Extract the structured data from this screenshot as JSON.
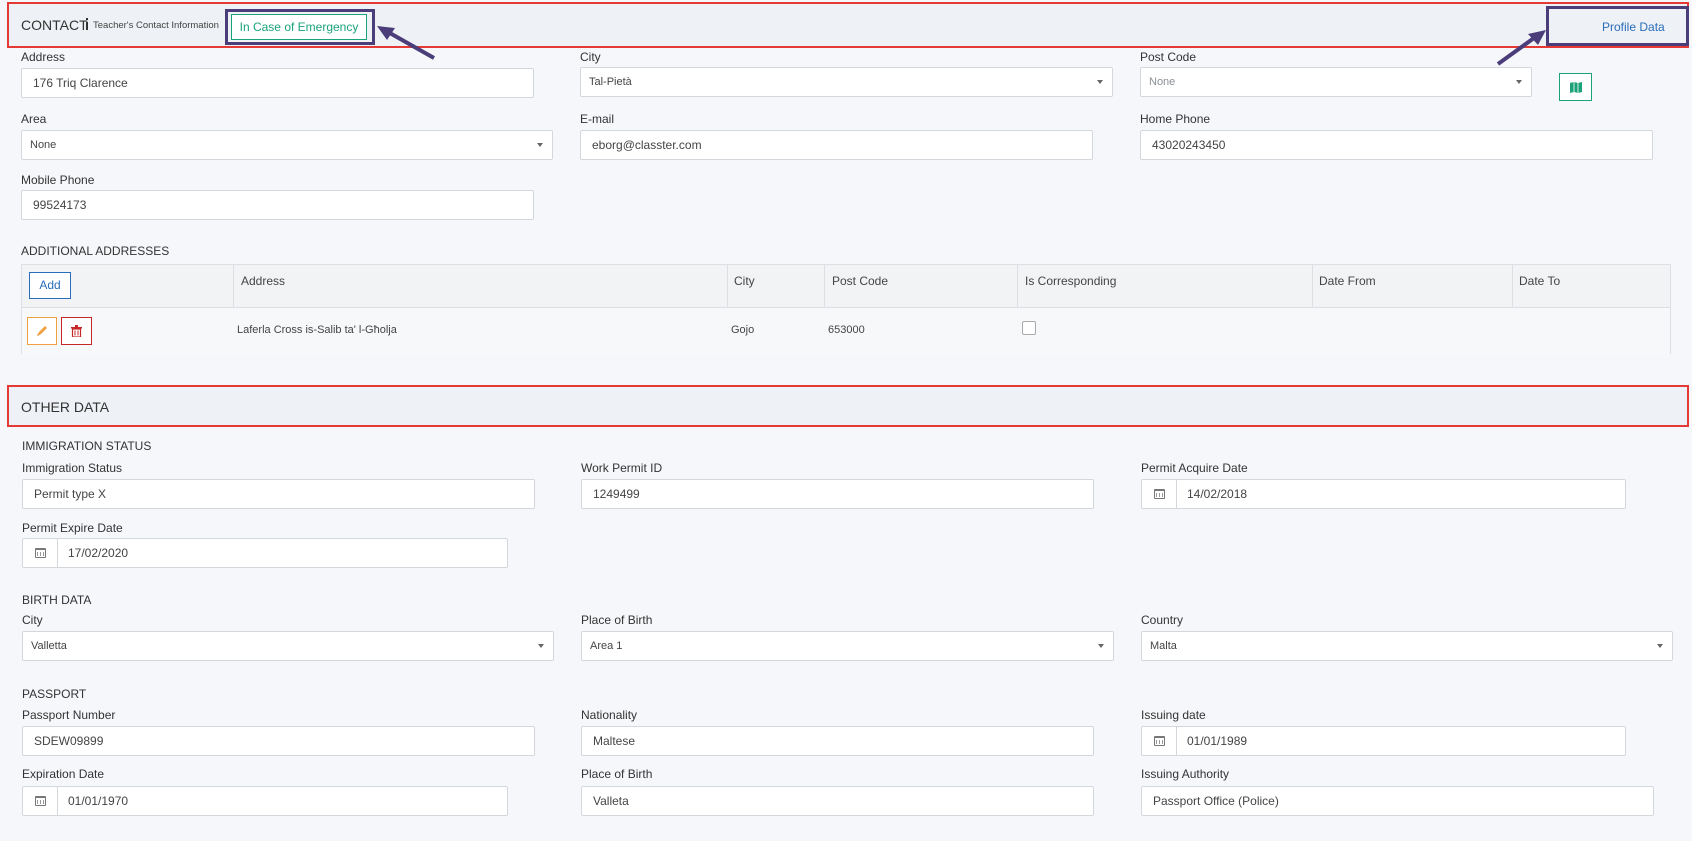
{
  "contact": {
    "title": "CONTACT",
    "info_icon": "info-icon",
    "subtitle": "Teacher's Contact Information",
    "emergency_button": "In Case of Emergency",
    "profile_link": "Profile Data",
    "address_label": "Address",
    "address_value": "176 Triq Clarence",
    "city_label": "City",
    "city_value": "Tal-Pietà",
    "postcode_label": "Post Code",
    "postcode_value": "None",
    "map_icon": "map-icon",
    "area_label": "Area",
    "area_value": "None",
    "email_label": "E-mail",
    "email_value": "eborg@classter.com",
    "home_phone_label": "Home Phone",
    "home_phone_value": "43020243450",
    "mobile_label": "Mobile Phone",
    "mobile_value": "99524173"
  },
  "additional_addresses": {
    "title": "ADDITIONAL ADDRESSES",
    "add_button": "Add",
    "columns": [
      "Address",
      "City",
      "Post Code",
      "Is Corresponding",
      "Date From",
      "Date To"
    ],
    "rows": [
      {
        "address": "Laferla Cross is-Salib ta' l-Għolja",
        "city": "Gojo",
        "post_code": "653000",
        "is_corresponding": false,
        "date_from": "",
        "date_to": ""
      }
    ]
  },
  "other_data": {
    "title": "OTHER DATA",
    "immigration": {
      "title": "IMMIGRATION STATUS",
      "status_label": "Immigration Status",
      "status_value": "Permit type X",
      "permit_id_label": "Work Permit ID",
      "permit_id_value": "1249499",
      "acquire_label": "Permit Acquire Date",
      "acquire_value": "14/02/2018",
      "expire_label": "Permit Expire Date",
      "expire_value": "17/02/2020"
    },
    "birth": {
      "title": "BIRTH DATA",
      "city_label": "City",
      "city_value": "Valletta",
      "place_label": "Place of Birth",
      "place_value": "Area 1",
      "country_label": "Country",
      "country_value": "Malta"
    },
    "passport": {
      "title": "PASSPORT",
      "number_label": "Passport Number",
      "number_value": "SDEW09899",
      "nationality_label": "Nationality",
      "nationality_value": "Maltese",
      "issuing_date_label": "Issuing date",
      "issuing_date_value": "01/01/1989",
      "expiration_label": "Expiration Date",
      "expiration_value": "01/01/1970",
      "place_label": "Place of Birth",
      "place_value": "Valleta",
      "authority_label": "Issuing Authority",
      "authority_value": "Passport Office (Police)"
    }
  },
  "colors": {
    "annotation_red": "#e53935",
    "annotation_purple": "#4a3d7a",
    "teal": "#1aa37a",
    "link_blue": "#2a6ebb"
  }
}
